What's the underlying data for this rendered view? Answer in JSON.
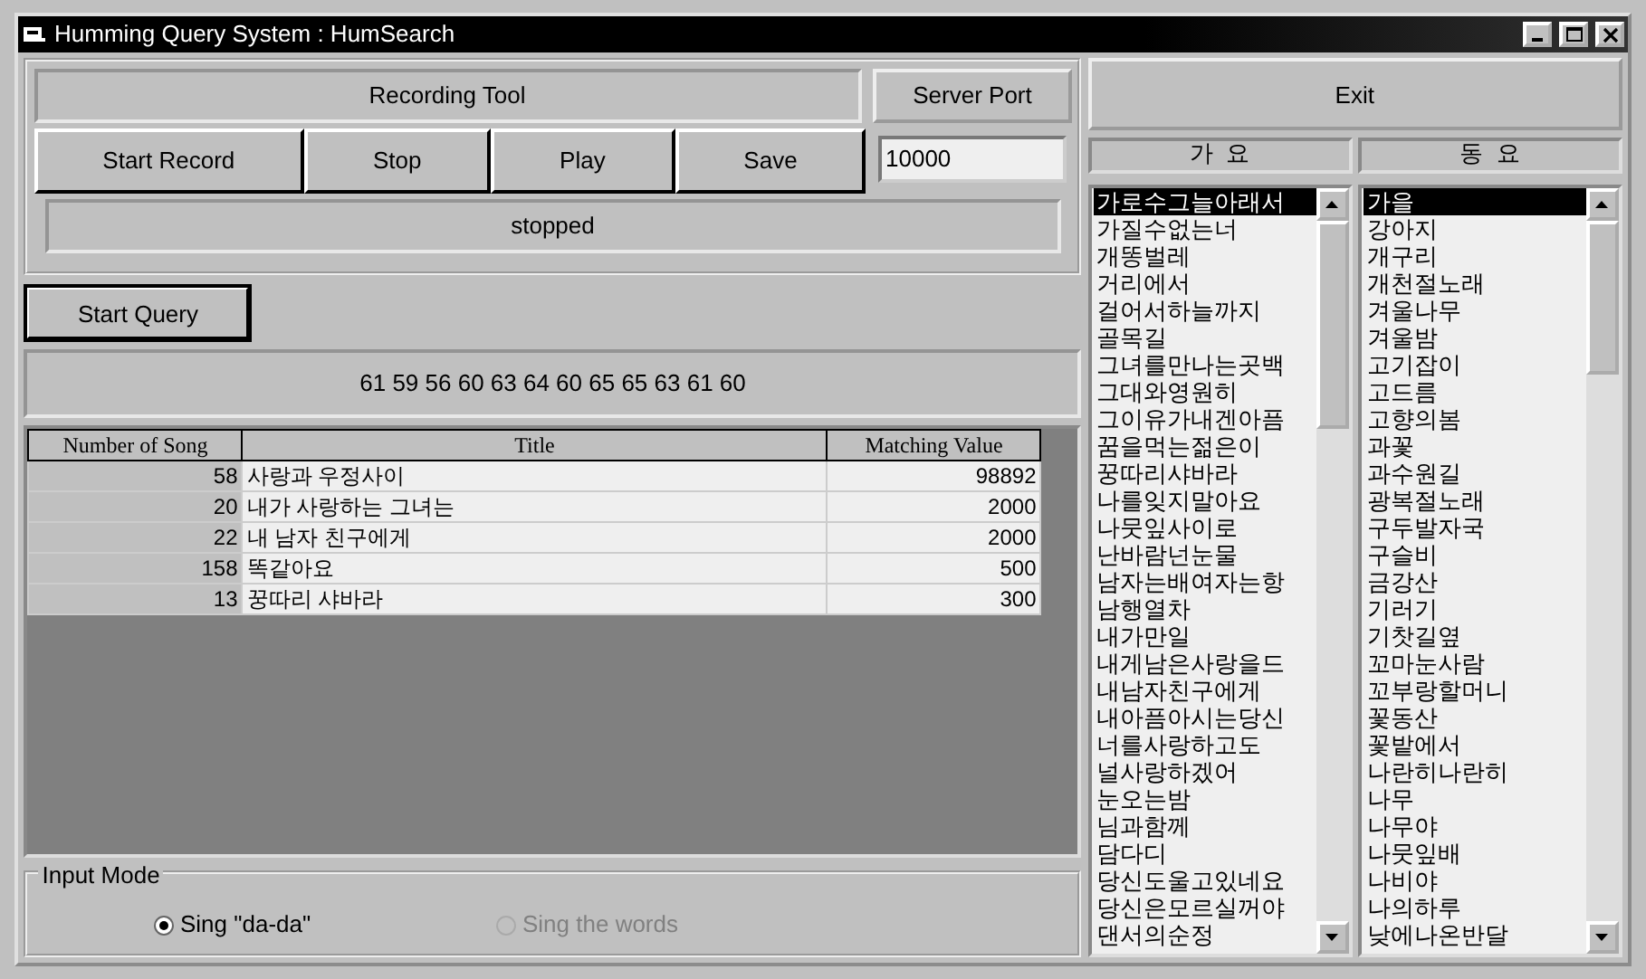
{
  "window": {
    "title": "Humming Query System : HumSearch"
  },
  "recording": {
    "title": "Recording Tool",
    "buttons": [
      "Start Record",
      "Stop",
      "Play",
      "Save"
    ],
    "status": "stopped"
  },
  "server": {
    "label": "Server Port",
    "value": "10000"
  },
  "query_button": "Start Query",
  "notes": "61 59 56 60 63 64 60 65 65 63 61 60",
  "table": {
    "columns": [
      "Number of Song",
      "Title",
      "Matching Value"
    ],
    "rows": [
      [
        "58",
        "사랑과  우정사이",
        "98892"
      ],
      [
        "20",
        "내가  사랑하는  그녀는",
        "2000"
      ],
      [
        "22",
        "내  남자  친구에게",
        "2000"
      ],
      [
        "158",
        "똑같아요",
        "500"
      ],
      [
        "13",
        "꿍따리  샤바라",
        "300"
      ]
    ]
  },
  "input_mode": {
    "label": "Input Mode",
    "options": [
      {
        "label": "Sing \"da-da\"",
        "selected": true,
        "disabled": false
      },
      {
        "label": "Sing the words",
        "selected": false,
        "disabled": true
      }
    ]
  },
  "exit_button": "Exit",
  "lists": [
    {
      "header": "가  요",
      "items": [
        {
          "label": "가로수그늘아래서",
          "selected": true
        },
        {
          "label": "가질수없는너",
          "selected": false
        },
        {
          "label": "개똥벌레",
          "selected": false
        },
        {
          "label": "거리에서",
          "selected": false
        },
        {
          "label": "걸어서하늘까지",
          "selected": false
        },
        {
          "label": "골목길",
          "selected": false
        },
        {
          "label": "그녀를만나는곳백",
          "selected": false
        },
        {
          "label": "그대와영원히",
          "selected": false
        },
        {
          "label": "그이유가내겐아픔",
          "selected": false
        },
        {
          "label": "꿈을먹는젊은이",
          "selected": false
        },
        {
          "label": "꿍따리샤바라",
          "selected": false
        },
        {
          "label": "나를잊지말아요",
          "selected": false
        },
        {
          "label": "나뭇잎사이로",
          "selected": false
        },
        {
          "label": "난바람넌눈물",
          "selected": false
        },
        {
          "label": "남자는배여자는항",
          "selected": false
        },
        {
          "label": "남행열차",
          "selected": false
        },
        {
          "label": "내가만일",
          "selected": false
        },
        {
          "label": "내게남은사랑을드",
          "selected": false
        },
        {
          "label": "내남자친구에게",
          "selected": false
        },
        {
          "label": "내아픔아시는당신",
          "selected": false
        },
        {
          "label": "너를사랑하고도",
          "selected": false
        },
        {
          "label": "널사랑하겠어",
          "selected": false
        },
        {
          "label": "눈오는밤",
          "selected": false
        },
        {
          "label": "님과함께",
          "selected": false
        },
        {
          "label": "담다디",
          "selected": false
        },
        {
          "label": "당신도울고있네요",
          "selected": false
        },
        {
          "label": "당신은모르실꺼야",
          "selected": false
        },
        {
          "label": "댄서의순정",
          "selected": false
        }
      ]
    },
    {
      "header": "동  요",
      "items": [
        {
          "label": "가을",
          "selected": true
        },
        {
          "label": "강아지",
          "selected": false
        },
        {
          "label": "개구리",
          "selected": false
        },
        {
          "label": "개천절노래",
          "selected": false
        },
        {
          "label": "겨울나무",
          "selected": false
        },
        {
          "label": "겨울밤",
          "selected": false
        },
        {
          "label": "고기잡이",
          "selected": false
        },
        {
          "label": "고드름",
          "selected": false
        },
        {
          "label": "고향의봄",
          "selected": false
        },
        {
          "label": "과꽃",
          "selected": false
        },
        {
          "label": "과수원길",
          "selected": false
        },
        {
          "label": "광복절노래",
          "selected": false
        },
        {
          "label": "구두발자국",
          "selected": false
        },
        {
          "label": "구슬비",
          "selected": false
        },
        {
          "label": "금강산",
          "selected": false
        },
        {
          "label": "기러기",
          "selected": false
        },
        {
          "label": "기찻길옆",
          "selected": false
        },
        {
          "label": "꼬마눈사람",
          "selected": false
        },
        {
          "label": "꼬부랑할머니",
          "selected": false
        },
        {
          "label": "꽃동산",
          "selected": false
        },
        {
          "label": "꽃밭에서",
          "selected": false
        },
        {
          "label": "나란히나란히",
          "selected": false
        },
        {
          "label": "나무",
          "selected": false
        },
        {
          "label": "나무야",
          "selected": false
        },
        {
          "label": "나뭇잎배",
          "selected": false
        },
        {
          "label": "나비야",
          "selected": false
        },
        {
          "label": "나의하루",
          "selected": false
        },
        {
          "label": "낮에나온반달",
          "selected": false
        }
      ]
    }
  ]
}
